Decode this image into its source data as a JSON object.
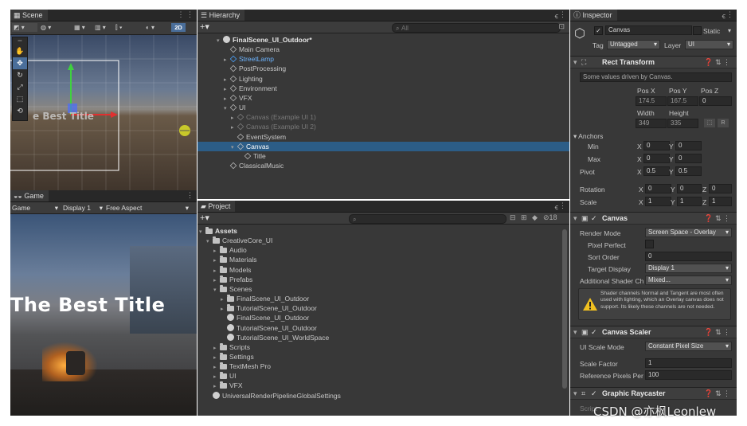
{
  "scene": {
    "tab": "Scene",
    "tool_2d": "2D",
    "overlay_title": "The Best Title"
  },
  "game": {
    "tab": "Game",
    "mode": "Game",
    "display": "Display 1",
    "aspect": "Free Aspect",
    "title_text": "The Best Title"
  },
  "hierarchy": {
    "tab": "Hierarchy",
    "search_placeholder": "All",
    "items": [
      {
        "label": "FinalScene_UI_Outdoor*",
        "indent": 0,
        "expand": "▾",
        "kind": "unity",
        "style": "bold"
      },
      {
        "label": "Main Camera",
        "indent": 1,
        "expand": "",
        "kind": "cube",
        "style": "normal"
      },
      {
        "label": "StreetLamp",
        "indent": 1,
        "expand": "▸",
        "kind": "cube-blue",
        "style": "blue"
      },
      {
        "label": "PostProcessing",
        "indent": 1,
        "expand": "",
        "kind": "cube",
        "style": "normal"
      },
      {
        "label": "Lighting",
        "indent": 1,
        "expand": "▸",
        "kind": "cube",
        "style": "normal"
      },
      {
        "label": "Environment",
        "indent": 1,
        "expand": "▸",
        "kind": "cube",
        "style": "normal"
      },
      {
        "label": "VFX",
        "indent": 1,
        "expand": "▸",
        "kind": "cube",
        "style": "normal"
      },
      {
        "label": "UI",
        "indent": 1,
        "expand": "▾",
        "kind": "cube",
        "style": "normal"
      },
      {
        "label": "Canvas (Example UI 1)",
        "indent": 2,
        "expand": "▸",
        "kind": "cube-grey",
        "style": "disabled"
      },
      {
        "label": "Canvas (Example UI 2)",
        "indent": 2,
        "expand": "▸",
        "kind": "cube-grey",
        "style": "disabled"
      },
      {
        "label": "EventSystem",
        "indent": 2,
        "expand": "",
        "kind": "cube",
        "style": "normal"
      },
      {
        "label": "Canvas",
        "indent": 2,
        "expand": "▾",
        "kind": "cube",
        "style": "selected"
      },
      {
        "label": "Title",
        "indent": 3,
        "expand": "",
        "kind": "cube",
        "style": "normal"
      },
      {
        "label": "ClassicalMusic",
        "indent": 1,
        "expand": "",
        "kind": "cube",
        "style": "normal"
      }
    ]
  },
  "project": {
    "tab": "Project",
    "badge": "18",
    "items": [
      {
        "label": "Assets",
        "indent": 0,
        "expand": "▾",
        "kind": "folder",
        "style": "bold"
      },
      {
        "label": "CreativeCore_UI",
        "indent": 1,
        "expand": "▾",
        "kind": "folder",
        "style": "normal"
      },
      {
        "label": "Audio",
        "indent": 2,
        "expand": "▸",
        "kind": "folder",
        "style": "normal"
      },
      {
        "label": "Materials",
        "indent": 2,
        "expand": "▸",
        "kind": "folder",
        "style": "normal"
      },
      {
        "label": "Models",
        "indent": 2,
        "expand": "▸",
        "kind": "folder",
        "style": "normal"
      },
      {
        "label": "Prefabs",
        "indent": 2,
        "expand": "▸",
        "kind": "folder",
        "style": "normal"
      },
      {
        "label": "Scenes",
        "indent": 2,
        "expand": "▾",
        "kind": "folder",
        "style": "normal"
      },
      {
        "label": "FinalScene_UI_Outdoor",
        "indent": 3,
        "expand": "▸",
        "kind": "folder",
        "style": "normal"
      },
      {
        "label": "TutorialScene_UI_Outdoor",
        "indent": 3,
        "expand": "▸",
        "kind": "folder",
        "style": "normal"
      },
      {
        "label": "FinalScene_UI_Outdoor",
        "indent": 3,
        "expand": "",
        "kind": "unity",
        "style": "normal"
      },
      {
        "label": "TutorialScene_UI_Outdoor",
        "indent": 3,
        "expand": "",
        "kind": "unity",
        "style": "normal"
      },
      {
        "label": "TutorialScene_UI_WorldSpace",
        "indent": 3,
        "expand": "",
        "kind": "unity",
        "style": "normal"
      },
      {
        "label": "Scripts",
        "indent": 2,
        "expand": "▸",
        "kind": "folder",
        "style": "normal"
      },
      {
        "label": "Settings",
        "indent": 2,
        "expand": "▸",
        "kind": "folder",
        "style": "normal"
      },
      {
        "label": "TextMesh Pro",
        "indent": 2,
        "expand": "▸",
        "kind": "folder",
        "style": "normal"
      },
      {
        "label": "UI",
        "indent": 2,
        "expand": "▸",
        "kind": "folder",
        "style": "normal"
      },
      {
        "label": "VFX",
        "indent": 2,
        "expand": "▸",
        "kind": "folder",
        "style": "normal"
      },
      {
        "label": "UniversalRenderPipelineGlobalSettings",
        "indent": 1,
        "expand": "",
        "kind": "unity",
        "style": "normal"
      }
    ]
  },
  "inspector": {
    "tab": "Inspector",
    "object_name": "Canvas",
    "static_label": "Static",
    "tag_label": "Tag",
    "tag_value": "Untagged",
    "layer_label": "Layer",
    "layer_value": "UI",
    "rect": {
      "title": "Rect Transform",
      "note": "Some values driven by Canvas.",
      "pos_x_label": "Pos X",
      "pos_y_label": "Pos Y",
      "pos_z_label": "Pos Z",
      "pos_x": "174.5",
      "pos_y": "167.5",
      "pos_z": "0",
      "width_label": "Width",
      "height_label": "Height",
      "width": "349",
      "height": "335",
      "anchors_label": "Anchors",
      "min_label": "Min",
      "max_label": "Max",
      "min_x": "0",
      "min_y": "0",
      "max_x": "0",
      "max_y": "0",
      "pivot_label": "Pivot",
      "pivot_x": "0.5",
      "pivot_y": "0.5",
      "rotation_label": "Rotation",
      "rot_x": "0",
      "rot_y": "0",
      "rot_z": "0",
      "scale_label": "Scale",
      "scale_x": "1",
      "scale_y": "1",
      "scale_z": "1",
      "x": "X",
      "y": "Y",
      "z": "Z",
      "r": "R"
    },
    "canvas": {
      "title": "Canvas",
      "render_mode_label": "Render Mode",
      "render_mode": "Screen Space - Overlay",
      "pixel_perfect_label": "Pixel Perfect",
      "sort_order_label": "Sort Order",
      "sort_order": "0",
      "target_display_label": "Target Display",
      "target_display": "Display 1",
      "shader_label": "Additional Shader Ch",
      "shader_value": "Mixed...",
      "warning": "Shader channels Normal and Tangent are most often used with lighting, which an Overlay canvas does not support. Its likely these channels are not needed."
    },
    "scaler": {
      "title": "Canvas Scaler",
      "mode_label": "UI Scale Mode",
      "mode_value": "Constant Pixel Size",
      "factor_label": "Scale Factor",
      "factor_value": "1",
      "ref_label": "Reference Pixels Per",
      "ref_value": "100"
    },
    "raycaster": {
      "title": "Graphic Raycaster",
      "partial": "Script"
    }
  },
  "watermark": "CSDN @亦枫Leonlew"
}
